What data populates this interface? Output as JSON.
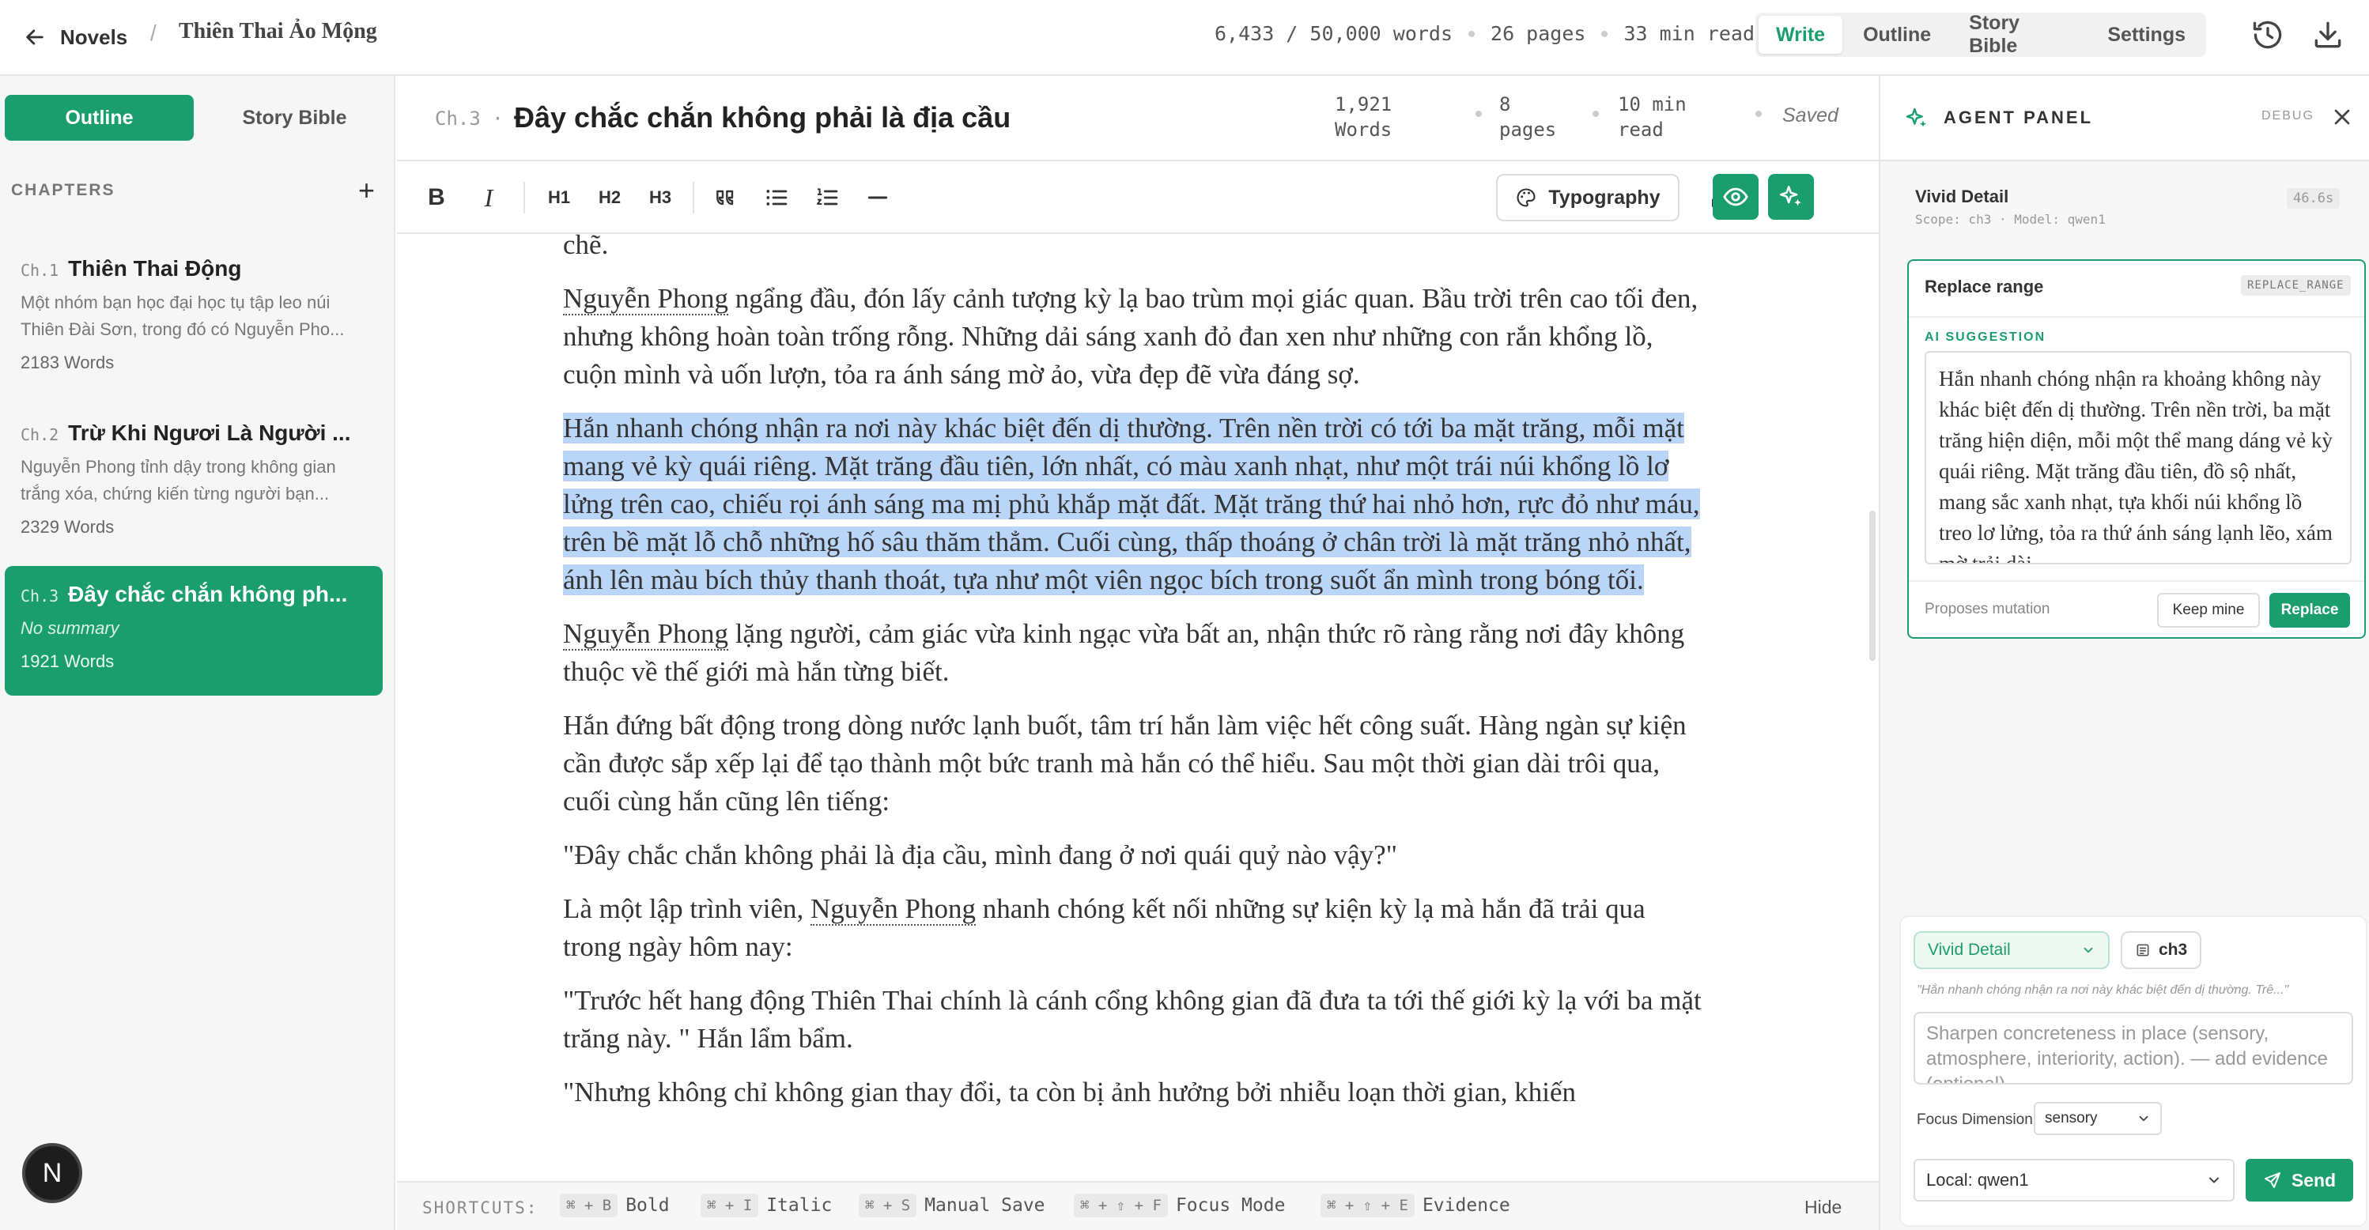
{
  "topbar": {
    "back_label": "Novels",
    "separator": "/",
    "novel_title": "Thiên Thai Ảo Mộng",
    "stats": [
      "6,433 / 50,000 words",
      "26 pages",
      "33 min read"
    ],
    "modes": [
      "Write",
      "Outline",
      "Story Bible",
      "Settings"
    ],
    "active_mode": "Write"
  },
  "sidebar": {
    "tabs": [
      "Outline",
      "Story Bible"
    ],
    "section_label": "CHAPTERS",
    "add_symbol": "+",
    "chapters": [
      {
        "num": "Ch.1",
        "title": "Thiên Thai Động",
        "summary": "Một nhóm bạn học đại học tụ tập leo núi Thiên Đài Sơn, trong đó có Nguyễn Pho...",
        "words": "2183 Words"
      },
      {
        "num": "Ch.2",
        "title": "Trừ Khi Ngươi Là Người ...",
        "summary": "Nguyễn Phong tỉnh dậy trong không gian trắng xóa, chứng kiến từng người bạn...",
        "words": "2329 Words"
      },
      {
        "num": "Ch.3",
        "title": "Đây chắc chắn không ph...",
        "summary": "No summary",
        "words": "1921 Words"
      }
    ],
    "avatar_letter": "N"
  },
  "editor": {
    "chapter_num": "Ch.3 ·",
    "chapter_title": "Đây chắc chắn không phải là địa cầu",
    "stats": {
      "words_value": "1,921",
      "words_label": "Words",
      "pages_value": "8",
      "pages_label": "pages",
      "read_value": "10 min",
      "read_label": "read"
    },
    "status": "Saved",
    "toolbar": {
      "bold": "B",
      "italic": "I",
      "h1": "H1",
      "h2": "H2",
      "h3": "H3",
      "typography": "Typography"
    },
    "paragraphs": {
      "p0": "Nguyễn Phong đứng giữa dòng nước, ngơ ngác, trong khi đôi mắt, tất cả đều dõi theo đó theo dõi chặt chẽ.",
      "p1_name": "Nguyễn Phong",
      "p1": " ngẩng đầu, đón lấy cảnh tượng kỳ lạ bao trùm mọi giác quan. Bầu trời trên cao tối đen, nhưng không hoàn toàn trống rỗng. Những dải sáng xanh đỏ đan xen như những con rắn khổng lồ, cuộn mình và uốn lượn, tỏa ra ánh sáng mờ ảo, vừa đẹp đẽ vừa đáng sợ.",
      "p2": "Hắn nhanh chóng nhận ra nơi này khác biệt đến dị thường. Trên nền trời có tới ba mặt trăng, mỗi mặt mang vẻ kỳ quái riêng. Mặt trăng đầu tiên, lớn nhất, có màu xanh nhạt, như một trái núi khổng lồ lơ lửng trên cao, chiếu rọi ánh sáng ma mị phủ khắp mặt đất. Mặt trăng thứ hai nhỏ hơn, rực đỏ như máu, trên bề mặt lỗ chỗ những hố sâu thăm thẳm. Cuối cùng, thấp thoáng ở chân trời là mặt trăng nhỏ nhất, ánh lên màu bích thủy thanh thoát, tựa như một viên ngọc bích trong suốt ẩn mình trong bóng tối.",
      "p3_name": "Nguyễn Phong",
      "p3": " lặng người, cảm giác vừa kinh ngạc vừa bất an, nhận thức rõ ràng rằng nơi đây không thuộc về thế giới mà hắn từng biết.",
      "p4": "Hắn đứng bất động trong dòng nước lạnh buốt, tâm trí hắn làm việc hết công suất. Hàng ngàn sự kiện cần được sắp xếp lại để tạo thành một bức tranh mà hắn có thể hiểu. Sau một thời gian dài trôi qua, cuối cùng hắn cũng lên tiếng:",
      "p5": "\"Đây chắc chắn không phải là địa cầu, mình đang ở nơi quái quỷ nào vậy?\"",
      "p6_a": "Là một lập trình viên, ",
      "p6_name": "Nguyễn Phong",
      "p6_b": " nhanh chóng kết nối những sự kiện kỳ lạ mà hắn đã trải qua trong ngày hôm nay:",
      "p7": "\"Trước hết hang động Thiên Thai chính là cánh cổng không gian đã đưa ta tới thế giới kỳ lạ với ba mặt trăng này. \" Hắn lẩm bẩm.",
      "p8": "\"Nhưng không chỉ không gian thay đổi, ta còn bị ảnh hưởng bởi nhiễu loạn thời gian, khiến"
    },
    "shortcuts": {
      "label": "SHORTCUTS:",
      "items": [
        {
          "keys": "⌘ + B",
          "action": "Bold"
        },
        {
          "keys": "⌘ + I",
          "action": "Italic"
        },
        {
          "keys": "⌘ + S",
          "action": "Manual Save"
        },
        {
          "keys": "⌘ + ⇧ + F",
          "action": "Focus Mode"
        },
        {
          "keys": "⌘ + ⇧ + E",
          "action": "Evidence"
        }
      ],
      "hide": "Hide"
    }
  },
  "agent": {
    "title": "AGENT PANEL",
    "debug": "DEBUG",
    "task": {
      "name": "Vivid Detail",
      "meta": "Scope: ch3 · Model: qwen1",
      "time": "46.6s"
    },
    "proposal": {
      "title": "Replace range",
      "tag": "REPLACE_RANGE",
      "ai_label": "AI SUGGESTION",
      "text": "Hắn nhanh chóng nhận ra khoảng không này khác biệt đến dị thường. Trên nền trời, ba mặt trăng hiện diện, mỗi một thể mang dáng vẻ kỳ quái riêng. Mặt trăng đầu tiên, đồ sộ nhất, mang sắc xanh nhạt, tựa khối núi khổng lồ treo lơ lửng, tỏa ra thứ ánh sáng lạnh lẽo, xám mờ trải dài",
      "proposes": "Proposes mutation",
      "keep": "Keep mine",
      "replace": "Replace"
    },
    "composer": {
      "skill": "Vivid Detail",
      "scope": "ch3",
      "quote": "\"Hắn nhanh chóng nhận ra nơi này khác biệt đến dị thường. Trê...\"",
      "prompt_placeholder": "Sharpen concreteness in place (sensory, atmosphere, interiority, action). — add evidence (optional)",
      "focus_label": "Focus Dimension",
      "focus_value": "sensory",
      "model": "Local: qwen1",
      "send": "Send"
    }
  },
  "colors": {
    "accent": "#1a9e6e",
    "selection": "#b9d5f7"
  }
}
